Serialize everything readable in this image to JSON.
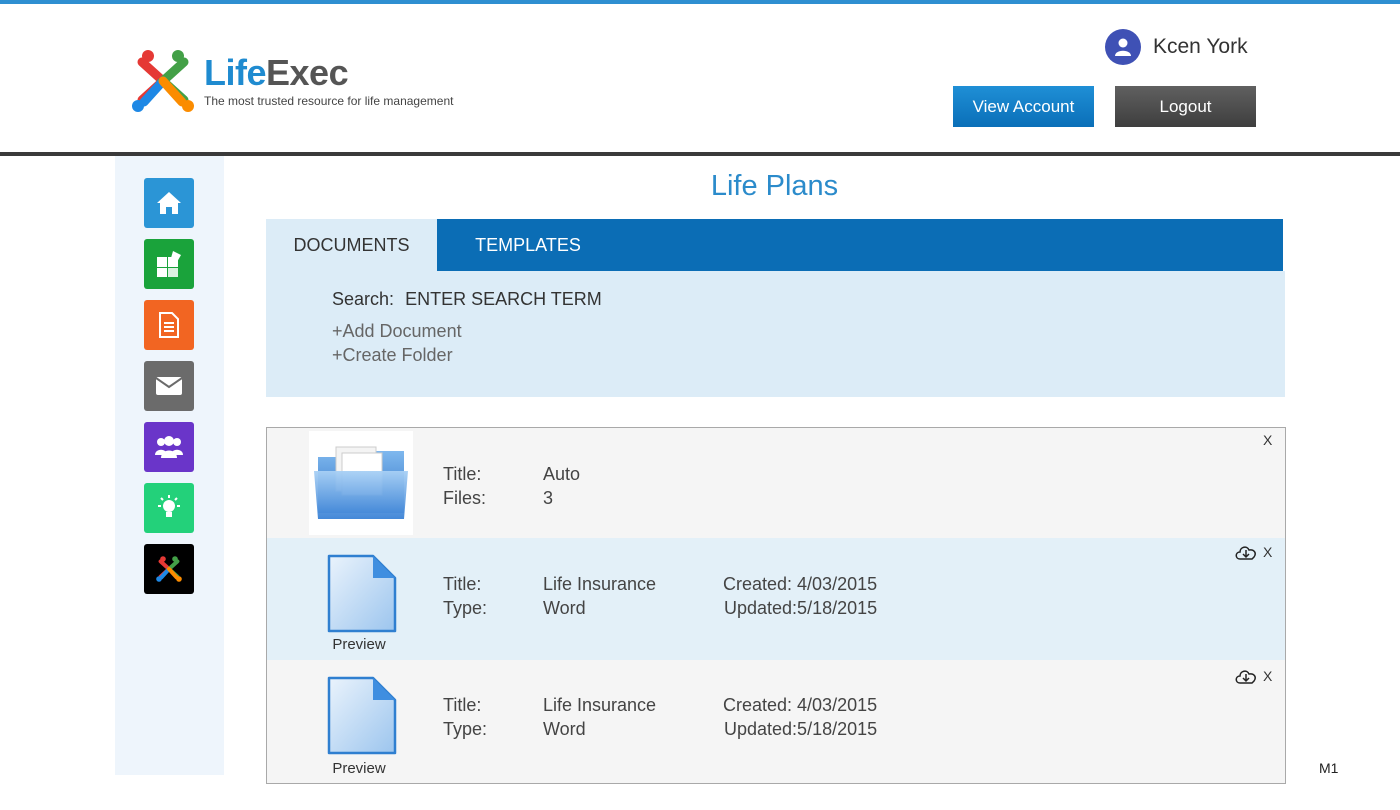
{
  "header": {
    "logo_part1": "Life",
    "logo_part2": "Exec",
    "tagline": "The most trusted resource for life management",
    "user_name": "Kcen York",
    "view_account_label": "View Account",
    "logout_label": "Logout"
  },
  "sidebar": {
    "items": [
      {
        "name": "home",
        "icon": "home-icon",
        "color": "#2b95d6"
      },
      {
        "name": "puzzle",
        "icon": "puzzle-icon",
        "color": "#1aa33b"
      },
      {
        "name": "document",
        "icon": "document-icon",
        "color": "#f26522"
      },
      {
        "name": "mail",
        "icon": "mail-icon",
        "color": "#6b6b6b"
      },
      {
        "name": "people",
        "icon": "people-icon",
        "color": "#6a35c9"
      },
      {
        "name": "lightbulb",
        "icon": "lightbulb-icon",
        "color": "#23d17a"
      },
      {
        "name": "lifeexec",
        "icon": "lifeexec-logo-icon",
        "color": "#000000"
      }
    ]
  },
  "main": {
    "title": "Life Plans",
    "tabs": [
      {
        "label": "DOCUMENTS",
        "active": true
      },
      {
        "label": "TEMPLATES",
        "active": false
      }
    ],
    "search": {
      "label": "Search:",
      "value": "ENTER SEARCH TERM"
    },
    "actions": {
      "add_document": "+Add Document",
      "create_folder": "+Create Folder"
    },
    "items": [
      {
        "kind": "folder",
        "title_label": "Title:",
        "title": "Auto",
        "files_label": "Files:",
        "files": "3",
        "close": "X"
      },
      {
        "kind": "document",
        "title_label": "Title:",
        "title": "Life Insurance",
        "type_label": "Type:",
        "type": "Word",
        "created": "Created:  4/03/2015",
        "updated": "Updated:5/18/2015",
        "preview": "Preview",
        "close": "X"
      },
      {
        "kind": "document",
        "title_label": "Title:",
        "title": "Life Insurance",
        "type_label": "Type:",
        "type": "Word",
        "created": "Created:  4/03/2015",
        "updated": "Updated:5/18/2015",
        "preview": "Preview",
        "close": "X"
      }
    ]
  },
  "page_marker": "M1",
  "colors": {
    "accent": "#1f8bd0",
    "tab_bar": "#0b6db5",
    "panel": "#dcecf7"
  }
}
